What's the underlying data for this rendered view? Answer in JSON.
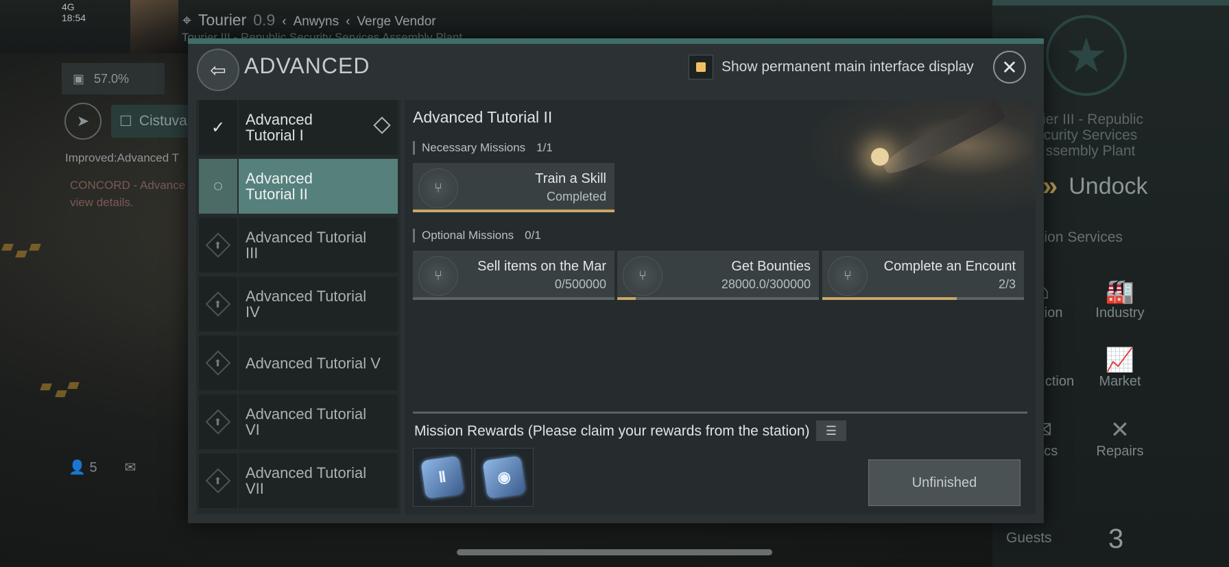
{
  "hud": {
    "signal": "4G",
    "time": "18:54",
    "location_name": "Tourier",
    "security": "0.9",
    "route_1": "Anwyns",
    "route_2": "Verge Vendor",
    "station_line": "Tourier III - Republic Security Services Assembly Plant",
    "cargo_percent": "57.0%",
    "nav_target": "Cistuva",
    "improved_text": "Improved:Advanced T",
    "concord_text": "CONCORD - Advance view details.",
    "pilots_count": "5"
  },
  "station": {
    "name": "rier III - Republic curity Services ssembly Plant",
    "undock_label": "Undock",
    "services_title": "ation Services",
    "services": [
      {
        "label": "se tion",
        "icon": "warehouse-icon"
      },
      {
        "label": "Industry",
        "icon": "industry-icon"
      },
      {
        "label": "etary ction",
        "icon": "planet-icon"
      },
      {
        "label": "Market",
        "icon": "market-icon"
      },
      {
        "label": "istics",
        "icon": "logistics-icon"
      },
      {
        "label": "Repairs",
        "icon": "repairs-icon"
      }
    ],
    "guests_label": "Guests",
    "guests_count": "3"
  },
  "modal": {
    "title": "ADVANCED",
    "permanent_display_label": "Show permanent main interface display",
    "tutorials": [
      {
        "label": "Advanced Tutorial I",
        "status": "completed"
      },
      {
        "label": "Advanced Tutorial II",
        "status": "active"
      },
      {
        "label": "Advanced Tutorial III",
        "status": "locked"
      },
      {
        "label": "Advanced Tutorial IV",
        "status": "locked"
      },
      {
        "label": "Advanced Tutorial V",
        "status": "locked"
      },
      {
        "label": "Advanced Tutorial VI",
        "status": "locked"
      },
      {
        "label": "Advanced Tutorial VII",
        "status": "locked"
      }
    ],
    "detail": {
      "title": "Advanced Tutorial II",
      "necessary_label": "Necessary Missions",
      "necessary_count": "1/1",
      "necessary_missions": [
        {
          "name": "Train a Skill",
          "progress": "Completed",
          "fraction": 1.0
        }
      ],
      "optional_label": "Optional Missions",
      "optional_count": "0/1",
      "optional_missions": [
        {
          "name": "Sell items on the Mar",
          "progress": "0/500000",
          "fraction": 0.0
        },
        {
          "name": "Get Bounties",
          "progress": "28000.0/300000",
          "fraction": 0.0933
        },
        {
          "name": "Complete an Encount",
          "progress": "2/3",
          "fraction": 0.6667
        }
      ],
      "rewards_label": "Mission Rewards (Please claim your rewards from the station)",
      "rewards": [
        {
          "icon": "skill-chip-icon"
        },
        {
          "icon": "skill-chip-icon"
        }
      ],
      "action_label": "Unfinished"
    }
  },
  "colors": {
    "accent_teal": "#56807b",
    "progress_gold": "#c9a766",
    "checkbox_dot": "#f0c060"
  }
}
